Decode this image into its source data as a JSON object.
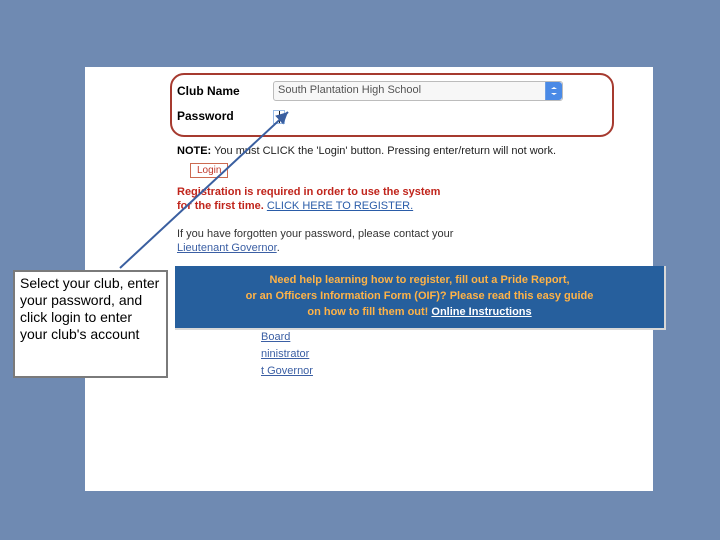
{
  "form": {
    "club_name_label": "Club Name",
    "club_name_value": "South Plantation High School",
    "password_label": "Password",
    "password_value": ""
  },
  "note": {
    "prefix": "NOTE:",
    "text": "You must CLICK the 'Login' button. Pressing enter/return will not work."
  },
  "login_button_label": "Login",
  "registration": {
    "line1": "Registration is required in order to use the system",
    "line2_prefix": "for the first time.",
    "link_text": "CLICK HERE TO REGISTER."
  },
  "forgot": {
    "line1": "If you have forgotten your password, please contact your",
    "link_text": "Lieutenant Governor"
  },
  "banner": {
    "line1": "Need help learning how to register, fill out a Pride Report,",
    "line2": "or an Officers Information Form (OIF)? Please read this easy guide",
    "line3_prefix": "on how to fill them out!",
    "link_text": "Online Instructions"
  },
  "role_links": {
    "item0": "Board",
    "item1": "ninistrator",
    "item2": "t Governor"
  },
  "callout": {
    "text": "Select your club, enter your password, and click login to enter your club's account"
  }
}
